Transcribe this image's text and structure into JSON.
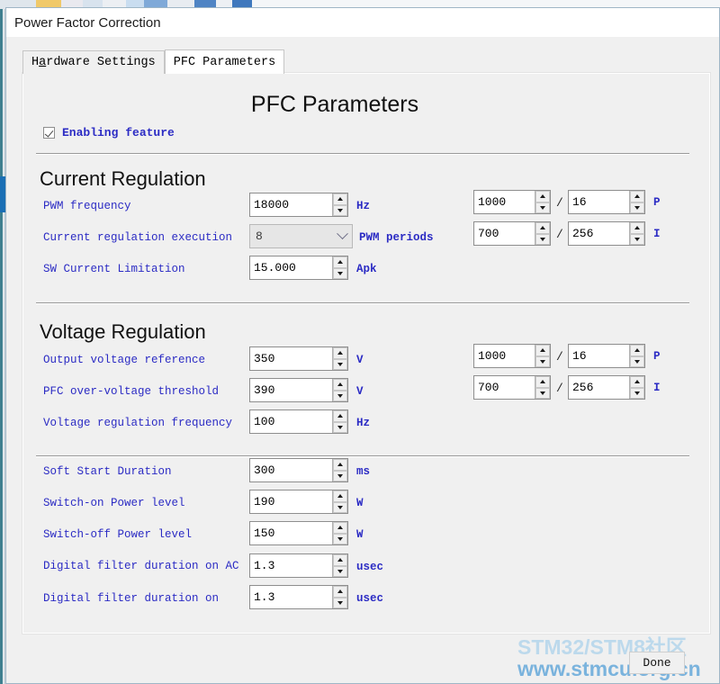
{
  "window": {
    "title": "Power Factor Correction"
  },
  "tabs": [
    {
      "label": "Hardware Settings",
      "active": false,
      "mnemonic_index": 9
    },
    {
      "label": "PFC Parameters",
      "active": true
    }
  ],
  "panel": {
    "title": "PFC Parameters",
    "enable_checkbox": {
      "label": "Enabling feature",
      "checked": true
    },
    "sections": [
      {
        "title": "Current Regulation",
        "rows": [
          {
            "label": "PWM frequency",
            "value": "18000",
            "unit": "Hz",
            "control": "spinner"
          },
          {
            "label": "Current regulation execution",
            "value": "8",
            "unit": "PWM periods",
            "control": "combo"
          },
          {
            "label": "SW Current Limitation",
            "value": "15.000",
            "unit": "Apk",
            "control": "spinner"
          }
        ],
        "gains": [
          {
            "numerator": "1000",
            "denominator": "16",
            "separator": "/",
            "unit": "P"
          },
          {
            "numerator": "700",
            "denominator": "256",
            "separator": "/",
            "unit": "I"
          }
        ]
      },
      {
        "title": "Voltage Regulation",
        "rows": [
          {
            "label": "Output voltage reference",
            "value": "350",
            "unit": "V",
            "control": "spinner"
          },
          {
            "label": "PFC over-voltage threshold",
            "value": "390",
            "unit": "V",
            "control": "spinner"
          },
          {
            "label": "Voltage regulation frequency",
            "value": "100",
            "unit": "Hz",
            "control": "spinner"
          }
        ],
        "gains": [
          {
            "numerator": "1000",
            "denominator": "16",
            "separator": "/",
            "unit": "P"
          },
          {
            "numerator": "700",
            "denominator": "256",
            "separator": "/",
            "unit": "I"
          }
        ]
      },
      {
        "title": "",
        "rows": [
          {
            "label": "Soft Start Duration",
            "value": "300",
            "unit": "ms",
            "control": "spinner"
          },
          {
            "label": "Switch-on Power level",
            "value": "190",
            "unit": "W",
            "control": "spinner"
          },
          {
            "label": "Switch-off Power level",
            "value": "150",
            "unit": "W",
            "control": "spinner"
          },
          {
            "label": "Digital filter duration on AC",
            "value": "1.3",
            "unit": "usec",
            "control": "spinner"
          },
          {
            "label": "Digital filter duration on",
            "value": "1.3",
            "unit": "usec",
            "control": "spinner"
          }
        ],
        "gains": []
      }
    ]
  },
  "footer": {
    "done_label": "Done"
  },
  "watermark": {
    "line1": "STM32/STM8社区",
    "line2": "www.stmcu.org.cn"
  },
  "colors": {
    "label_blue": "#2b2bc4",
    "accent_blue": "#1a6fb5",
    "watermark_top": "#bcd9ec",
    "watermark_bottom": "#7ab3dd",
    "panel_bg": "#f0f0f0"
  }
}
